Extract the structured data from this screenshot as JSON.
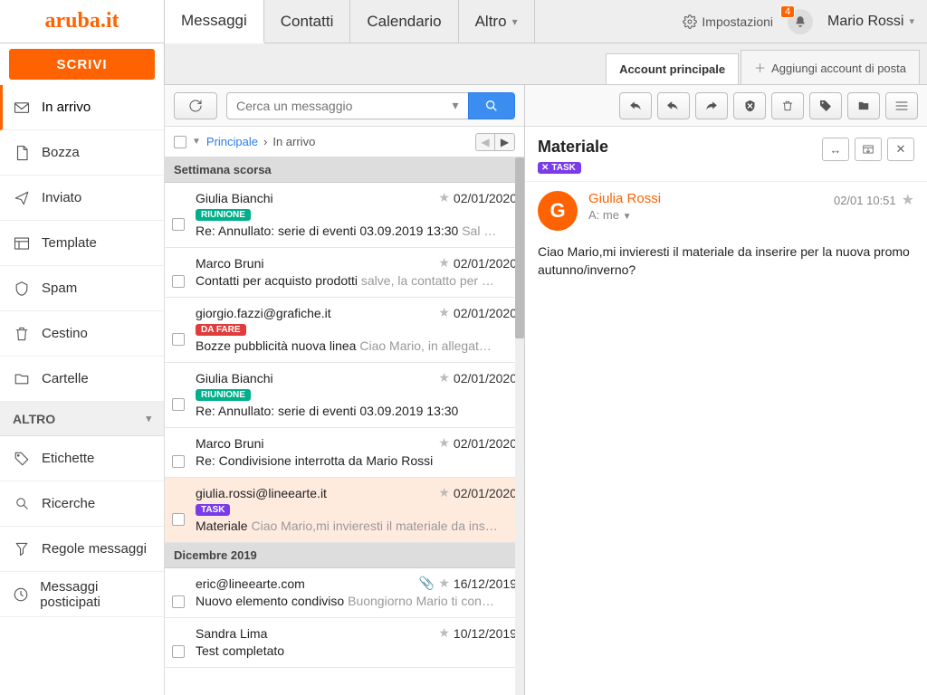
{
  "brand": "aruba.it",
  "topTabs": [
    {
      "label": "Messaggi",
      "active": true
    },
    {
      "label": "Contatti",
      "active": false
    },
    {
      "label": "Calendario",
      "active": false
    },
    {
      "label": "Altro",
      "active": false,
      "dropdown": true
    }
  ],
  "settingsLabel": "Impostazioni",
  "notificationCount": "4",
  "userName": "Mario Rossi",
  "composeLabel": "SCRIVI",
  "accountTabs": {
    "main": "Account principale",
    "add": "Aggiungi account di posta"
  },
  "searchPlaceholder": "Cerca un messaggio",
  "breadcrumb": {
    "root": "Principale",
    "current": "In arrivo"
  },
  "folders": [
    {
      "key": "inbox",
      "label": "In arrivo",
      "active": true
    },
    {
      "key": "draft",
      "label": "Bozza"
    },
    {
      "key": "sent",
      "label": "Inviato"
    },
    {
      "key": "template",
      "label": "Template"
    },
    {
      "key": "spam",
      "label": "Spam"
    },
    {
      "key": "trash",
      "label": "Cestino"
    },
    {
      "key": "folders",
      "label": "Cartelle"
    }
  ],
  "sectionOther": "ALTRO",
  "otherItems": [
    {
      "key": "labels",
      "label": "Etichette"
    },
    {
      "key": "searches",
      "label": "Ricerche"
    },
    {
      "key": "rules",
      "label": "Regole messaggi"
    },
    {
      "key": "snoozed",
      "label": "Messaggi posticipati"
    }
  ],
  "groups": [
    {
      "header": "Settimana scorsa",
      "messages": [
        {
          "from": "Giulia Bianchi",
          "date": "02/01/2020",
          "tag": {
            "text": "RIUNIONE",
            "color": "#00b08b"
          },
          "subject": "Re: Annullato: serie di eventi 03.09.2019 13:30",
          "preview": "Sal …"
        },
        {
          "from": "Marco Bruni",
          "date": "02/01/2020",
          "subject": "Contatti per acquisto prodotti",
          "preview": "salve, la contatto per …"
        },
        {
          "from": "giorgio.fazzi@grafiche.it",
          "date": "02/01/2020",
          "tag": {
            "text": "DA FARE",
            "color": "#e23b3b"
          },
          "subject": "Bozze pubblicità nuova linea",
          "preview": "Ciao Mario, in allegat…"
        },
        {
          "from": "Giulia Bianchi",
          "date": "02/01/2020",
          "tag": {
            "text": "RIUNIONE",
            "color": "#00b08b"
          },
          "subject": "Re: Annullato: serie di eventi 03.09.2019 13:30",
          "preview": ""
        },
        {
          "from": "Marco Bruni",
          "date": "02/01/2020",
          "subject": "Re: Condivisione interrotta da Mario Rossi",
          "preview": ""
        },
        {
          "from": "giulia.rossi@lineearte.it",
          "date": "02/01/2020",
          "tag": {
            "text": "TASK",
            "color": "#7a3ce8"
          },
          "subject": "Materiale",
          "preview": "Ciao Mario,mi invieresti il materiale da ins…",
          "selected": true
        }
      ]
    },
    {
      "header": "Dicembre 2019",
      "messages": [
        {
          "from": "eric@lineearte.com",
          "date": "16/12/2019",
          "attachment": true,
          "subject": "Nuovo elemento condiviso",
          "preview": "Buongiorno Mario ti con…"
        },
        {
          "from": "Sandra Lima",
          "date": "10/12/2019",
          "subject": "Test completato",
          "preview": ""
        }
      ]
    }
  ],
  "reader": {
    "subject": "Materiale",
    "tag": {
      "text": "TASK",
      "color": "#7a3ce8"
    },
    "fromName": "Giulia Rossi",
    "avatarInitial": "G",
    "avatarColor": "#ff6200",
    "toLabel": "A: me",
    "datetime": "02/01 10:51",
    "body": "Ciao Mario,mi invieresti il materiale da inserire per la nuova promo autunno/inverno?"
  }
}
